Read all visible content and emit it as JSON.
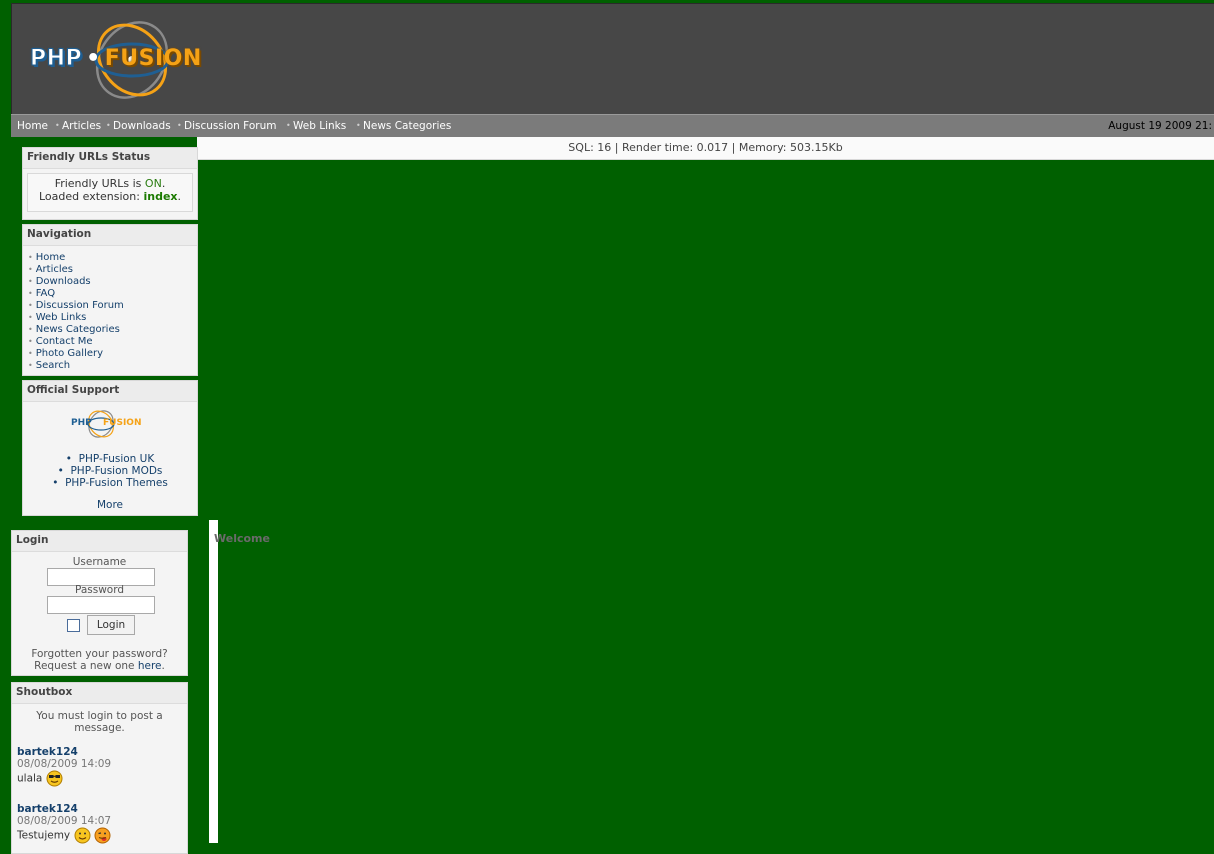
{
  "header": {
    "logo_left": "PHP",
    "logo_dot": "•",
    "logo_right": "FUSION"
  },
  "topnav": {
    "items": [
      "Home",
      "Articles",
      "Downloads",
      "Discussion Forum",
      "Web Links",
      "News Categories"
    ],
    "date": "August 19 2009 21:"
  },
  "stats": "SQL: 16 | Render time: 0.017 | Memory: 503.15Kb",
  "friendly_urls": {
    "title": "Friendly URLs Status",
    "line1_prefix": "Friendly URLs is ",
    "line1_value": "ON",
    "line1_suffix": ".",
    "line2_prefix": "Loaded extension: ",
    "line2_value": "index",
    "line2_suffix": "."
  },
  "navigation": {
    "title": "Navigation",
    "items": [
      "Home",
      "Articles",
      "Downloads",
      "FAQ",
      "Discussion Forum",
      "Web Links",
      "News Categories",
      "Contact Me",
      "Photo Gallery",
      "Search"
    ]
  },
  "support": {
    "title": "Official Support",
    "logo_left": "PHP",
    "logo_right": "FUSION",
    "items": [
      "PHP-Fusion UK",
      "PHP-Fusion MODs",
      "PHP-Fusion Themes"
    ],
    "more": "More"
  },
  "login": {
    "title": "Login",
    "username_label": "Username",
    "password_label": "Password",
    "button": "Login",
    "forgot": "Forgotten your password?",
    "request_prefix": "Request a new one ",
    "request_link": "here",
    "request_suffix": "."
  },
  "shoutbox": {
    "title": "Shoutbox",
    "notice": "You must login to post a message.",
    "entries": [
      {
        "user": "bartek124",
        "date": "08/08/2009 14:09",
        "message": "ulala"
      },
      {
        "user": "bartek124",
        "date": "08/08/2009 14:07",
        "message": "Testujemy"
      }
    ]
  },
  "main": {
    "welcome": "Welcome"
  },
  "colors": {
    "page_bg": "#006000",
    "header_bg": "#474747",
    "nav_bg": "#7b7b7b",
    "link": "#15406b",
    "logo_orange": "#f5a216",
    "logo_blue": "#1f5f93"
  }
}
